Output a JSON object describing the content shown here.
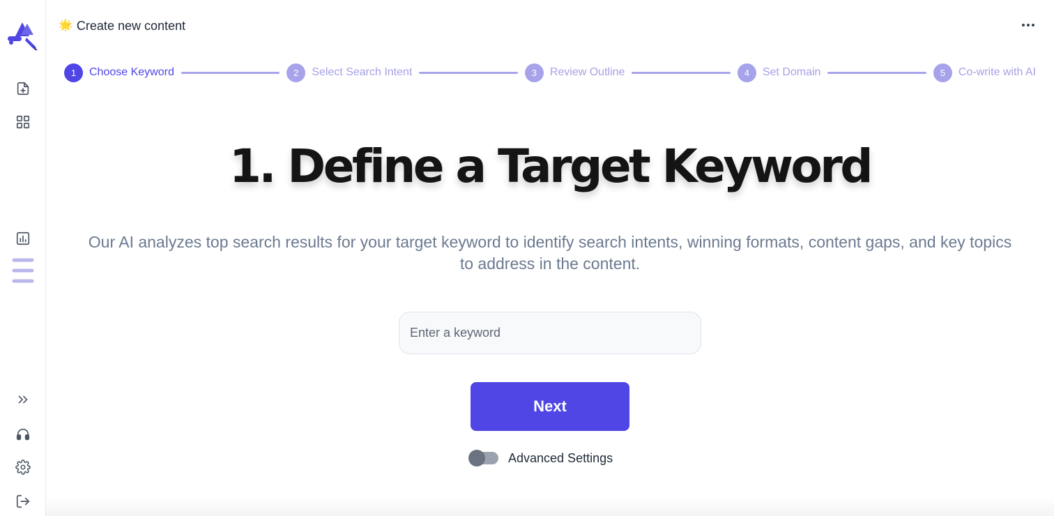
{
  "app": {
    "header_icon": "sparkle-emoji",
    "header_spark_glyph": "🌟",
    "page_title": "Create new content",
    "more_icon": "more-horizontal-icon"
  },
  "sidebar": {
    "logo_icon": "app-logo",
    "items": [
      {
        "name": "new-document",
        "icon": "file-plus-icon"
      },
      {
        "name": "dashboard",
        "icon": "grid-icon"
      },
      {
        "name": "analytics",
        "icon": "bar-chart-icon"
      },
      {
        "name": "menu",
        "icon": "hamburger-menu-icon"
      },
      {
        "name": "expand",
        "icon": "chevrons-right-icon"
      },
      {
        "name": "support",
        "icon": "headphones-icon"
      },
      {
        "name": "settings",
        "icon": "gear-icon"
      },
      {
        "name": "logout",
        "icon": "logout-icon"
      }
    ]
  },
  "stepper": {
    "steps": [
      {
        "number": "1",
        "label": "Choose Keyword",
        "active": true
      },
      {
        "number": "2",
        "label": "Select Search Intent",
        "active": false
      },
      {
        "number": "3",
        "label": "Review Outline",
        "active": false
      },
      {
        "number": "4",
        "label": "Set Domain",
        "active": false
      },
      {
        "number": "5",
        "label": "Co-write with AI",
        "active": false
      }
    ]
  },
  "main": {
    "heading": "1. Define a Target Keyword",
    "subtitle": "Our AI analyzes top search results for your target keyword to identify search intents, winning formats, content gaps, and key topics to address in the content.",
    "keyword_input": {
      "placeholder": "Enter a keyword",
      "value": ""
    },
    "next_label": "Next",
    "advanced_settings_label": "Advanced Settings",
    "advanced_settings_enabled": false
  },
  "colors": {
    "accent": "#4f46e5",
    "accent_light": "#a7a3ea",
    "sidebar_icon": "#4b5563",
    "menu_icon": "#b9b6ee",
    "muted_text": "#6b7a90"
  }
}
